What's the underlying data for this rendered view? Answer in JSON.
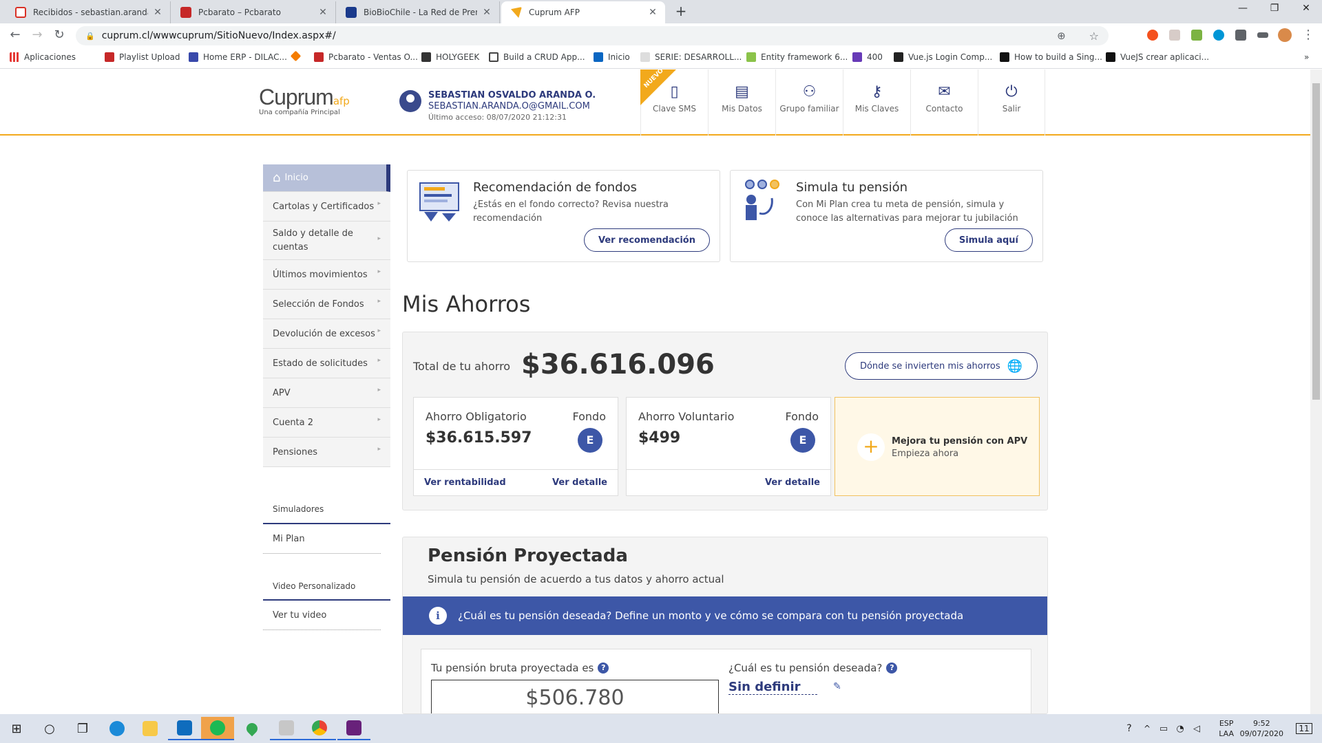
{
  "browser": {
    "tabs": [
      {
        "title": "Recibidos - sebastian.aranda.o@",
        "color": "#d93025"
      },
      {
        "title": "Pcbarato – Pcbarato",
        "color": "#c62828"
      },
      {
        "title": "BioBioChile - La Red de Prensa M",
        "color": "#1a3a8c"
      },
      {
        "title": "Cuprum AFP",
        "color": "#f2a91c"
      }
    ],
    "url": "cuprum.cl/wwwcuprum/SitioNuevo/Index.aspx#/",
    "bookmarks": [
      {
        "label": "Aplicaciones",
        "color": "#e53935"
      },
      {
        "label": "Playlist Upload",
        "color": "#c62828"
      },
      {
        "label": "Home ERP - DILAC...",
        "color": "#3949ab"
      },
      {
        "label": "",
        "color": "#f57c00"
      },
      {
        "label": "Pcbarato - Ventas O...",
        "color": "#c62828"
      },
      {
        "label": "HOLYGEEK",
        "color": "#333333"
      },
      {
        "label": "Build a CRUD App...",
        "color": "#444444"
      },
      {
        "label": "Inicio",
        "color": "#0a66c2"
      },
      {
        "label": "SERIE: DESARROLL...",
        "color": "#aaaaaa"
      },
      {
        "label": "Entity framework 6...",
        "color": "#8bc34a"
      },
      {
        "label": "400",
        "color": "#673ab7"
      },
      {
        "label": "Vue.js Login Comp...",
        "color": "#222222"
      },
      {
        "label": "How to build a Sing...",
        "color": "#111111"
      },
      {
        "label": "VueJS crear aplicaci...",
        "color": "#111111"
      }
    ],
    "bookmarks_more": "»"
  },
  "header": {
    "logo_name": "Cuprum",
    "logo_afp": "afp",
    "logo_sub": "Una compañía Principal",
    "user_name": "SEBASTIAN OSVALDO ARANDA O.",
    "user_email": "SEBASTIAN.ARANDA.O@GMAIL.COM",
    "last_access": "Último acceso: 08/07/2020 21:12:31",
    "badge": "NUEVO",
    "nav": [
      "Clave SMS",
      "Mis Datos",
      "Grupo familiar",
      "Mis Claves",
      "Contacto",
      "Salir"
    ]
  },
  "sidebar": {
    "active": "Inicio",
    "items": [
      "Cartolas y Certificados",
      "Saldo y detalle de cuentas",
      "Últimos movimientos",
      "Selección de Fondos",
      "Devolución de excesos",
      "Estado de solicitudes",
      "APV",
      "Cuenta 2",
      "Pensiones"
    ],
    "sec1_title": "Simuladores",
    "sec1_link": "Mi Plan",
    "sec2_title": "Video Personalizado",
    "sec2_link": "Ver tu video"
  },
  "promos": [
    {
      "title": "Recomendación de fondos",
      "desc": "¿Estás en el fondo correcto? Revisa nuestra recomendación",
      "button": "Ver recomendación"
    },
    {
      "title": "Simula tu pensión",
      "desc": "Con Mi Plan crea tu meta de pensión, simula y conoce las alternativas para mejorar tu jubilación",
      "button": "Simula aquí"
    }
  ],
  "ahorros": {
    "title": "Mis Ahorros",
    "total_label": "Total de tu ahorro",
    "total_value": "$36.616.096",
    "donde_button": "Dónde se invierten mis ahorros",
    "obligatorio": {
      "label": "Ahorro Obligatorio",
      "fondo_label": "Fondo",
      "value": "$36.615.597",
      "fondo": "E",
      "link1": "Ver rentabilidad",
      "link2": "Ver detalle"
    },
    "voluntario": {
      "label": "Ahorro Voluntario",
      "fondo_label": "Fondo",
      "value": "$499",
      "fondo": "E",
      "link2": "Ver detalle"
    },
    "apv_title": "Mejora tu pensión con APV",
    "apv_sub": "Empieza ahora"
  },
  "pension": {
    "title": "Pensión Proyectada",
    "subtitle": "Simula tu pensión de acuerdo a tus datos y ahorro actual",
    "banner": "¿Cuál es tu pensión deseada? Define un monto y ve cómo se compara con tu pensión proyectada",
    "projected_label": "Tu pensión bruta proyectada es",
    "projected_value": "$506.780",
    "desired_label": "¿Cuál es tu pensión deseada?",
    "desired_value": "Sin definir"
  },
  "taskbar": {
    "lang1": "ESP",
    "lang2": "LAA",
    "time": "9:52",
    "date": "09/07/2020",
    "notif": "11"
  }
}
